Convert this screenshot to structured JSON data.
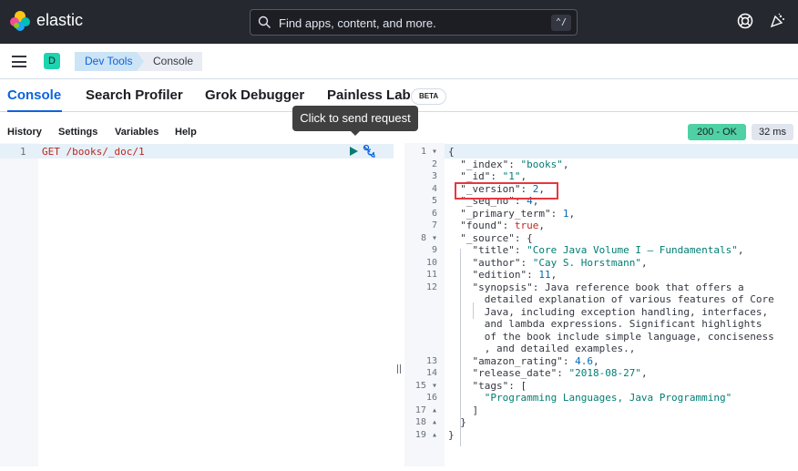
{
  "header": {
    "brand": "elastic",
    "search_placeholder": "Find apps, content, and more.",
    "search_shortcut": "⌃/"
  },
  "subnav": {
    "space_badge": "D",
    "breadcrumbs": [
      "Dev Tools",
      "Console"
    ]
  },
  "tabs": [
    {
      "label": "Console",
      "active": true
    },
    {
      "label": "Search Profiler"
    },
    {
      "label": "Grok Debugger"
    },
    {
      "label": "Painless Lab",
      "badge": "BETA"
    }
  ],
  "console_menu": [
    "History",
    "Settings",
    "Variables",
    "Help"
  ],
  "tooltip": "Click to send request",
  "status": {
    "code": "200 - OK",
    "time": "32 ms"
  },
  "request": {
    "line_number": "1",
    "text": "GET /books/_doc/1"
  },
  "response_lines": [
    {
      "n": "1 ▾",
      "text": "{"
    },
    {
      "n": "2",
      "text": "  \"_index\": \"books\","
    },
    {
      "n": "3",
      "text": "  \"_id\": \"1\","
    },
    {
      "n": "4",
      "text": "  \"_version\": 2,"
    },
    {
      "n": "5",
      "text": "  \"_seq_no\": 4,"
    },
    {
      "n": "6",
      "text": "  \"_primary_term\": 1,"
    },
    {
      "n": "7",
      "text": "  \"found\": true,"
    },
    {
      "n": "8 ▾",
      "text": "  \"_source\": {"
    },
    {
      "n": "9",
      "text": "    \"title\": \"Core Java Volume I – Fundamentals\","
    },
    {
      "n": "10",
      "text": "    \"author\": \"Cay S. Horstmann\","
    },
    {
      "n": "11",
      "text": "    \"edition\": 11,"
    },
    {
      "n": "12",
      "text": "    \"synopsis\": \"Java reference book that offers a"
    },
    {
      "n": "",
      "text": "      detailed explanation of various features of Core"
    },
    {
      "n": "",
      "text": "      Java, including exception handling, interfaces,"
    },
    {
      "n": "",
      "text": "      and lambda expressions. Significant highlights"
    },
    {
      "n": "",
      "text": "      of the book include simple language, conciseness"
    },
    {
      "n": "",
      "text": "      , and detailed examples.\","
    },
    {
      "n": "13",
      "text": "    \"amazon_rating\": 4.6,"
    },
    {
      "n": "14",
      "text": "    \"release_date\": \"2018-08-27\","
    },
    {
      "n": "15 ▾",
      "text": "    \"tags\": ["
    },
    {
      "n": "16",
      "text": "      \"Programming Languages, Java Programming\""
    },
    {
      "n": "17 ▴",
      "text": "    ]"
    },
    {
      "n": "18 ▴",
      "text": "  }"
    },
    {
      "n": "19 ▴",
      "text": "}"
    }
  ],
  "colors": {
    "accent": "#0b64dd",
    "ok": "#4fd1a5",
    "header": "#25282f",
    "highlight": "#e7373f"
  }
}
